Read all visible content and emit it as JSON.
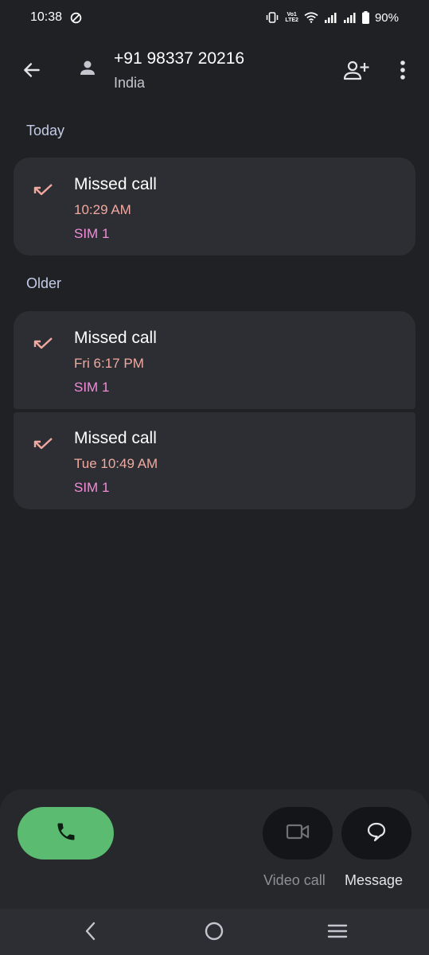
{
  "status_bar": {
    "time": "10:38",
    "volte_top": "Vo1",
    "volte_bottom": "LTE2",
    "battery": "90%"
  },
  "header": {
    "number": "+91 98337 20216",
    "region": "India"
  },
  "sections": {
    "today": "Today",
    "older": "Older"
  },
  "calls": [
    {
      "type": "Missed call",
      "time": "10:29 AM",
      "sim": "SIM 1"
    },
    {
      "type": "Missed call",
      "time": "Fri 6:17 PM",
      "sim": "SIM 1"
    },
    {
      "type": "Missed call",
      "time": "Tue 10:49 AM",
      "sim": "SIM 1"
    }
  ],
  "actions": {
    "video_label": "Video call",
    "message_label": "Message"
  },
  "colors": {
    "background": "#202125",
    "card": "#2d2e33",
    "call_green": "#5abb71",
    "missed_red": "#f0a9a0",
    "sim_pink": "#f08cd8"
  }
}
